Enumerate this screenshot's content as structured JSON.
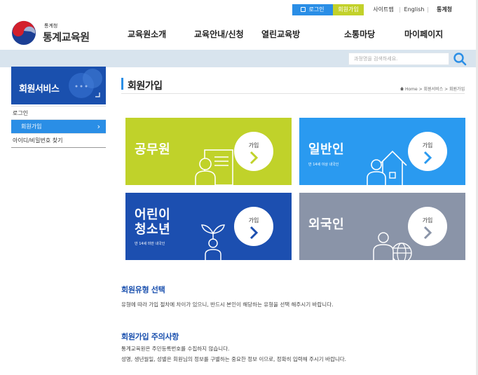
{
  "utility": {
    "login": "로그인",
    "join": "회원가입",
    "sitemap": "사이트맵",
    "english": "English",
    "kostat": "통계청"
  },
  "logo": {
    "org": "통계청",
    "name": "통계교육원"
  },
  "gnb": [
    "교육원소개",
    "교육안내/신청",
    "열린교육방",
    "소통마당",
    "마이페이지"
  ],
  "search": {
    "placeholder": "과정명을 검색하세요."
  },
  "sidebar": {
    "title": "회원서비스",
    "items": [
      {
        "label": "로그인",
        "active": false
      },
      {
        "label": "회원가입",
        "active": true
      },
      {
        "label": "아이디/비밀번호 찾기",
        "active": false
      }
    ]
  },
  "page": {
    "title": "회원가입",
    "breadcrumb": "Home > 회원서비스 > 회원가입"
  },
  "cards": [
    {
      "title": "공무원",
      "subtitle": "",
      "button": "가입",
      "color": "#c0d22a",
      "icon": "person-document-icon"
    },
    {
      "title": "일반인",
      "subtitle": "만 14세 이상 내국인",
      "button": "가입",
      "color": "#2a9af0",
      "icon": "person-house-icon"
    },
    {
      "title": "어린이\n청소년",
      "line1": "어린이",
      "line2": "청소년",
      "subtitle": "만 14세 미만 내국인",
      "button": "가입",
      "color": "#1c4fb0",
      "icon": "child-sprout-icon"
    },
    {
      "title": "외국인",
      "subtitle": "",
      "button": "가입",
      "color": "#8a94a8",
      "icon": "person-globe-icon"
    }
  ],
  "sections": [
    {
      "title": "회원유형 선택",
      "lines": [
        "유형에 따라 가입 절차에 차이가 있으니, 반드시 본인이 해당하는 유형을 선택 해주시기 바랍니다."
      ]
    },
    {
      "title": "회원가입 주의사항",
      "lines": [
        "통계교육원은 주민등록번호를 수집하지 않습니다.",
        "성명, 생년월일, 성별은 회원님의 정보를 구별하는 중요한 정보 이므로, 정확히 입력해 주시기 바랍니다."
      ]
    }
  ],
  "colors": {
    "accent": "#2a8ee6",
    "green": "#c2d12a",
    "navy": "#1a50ae"
  }
}
